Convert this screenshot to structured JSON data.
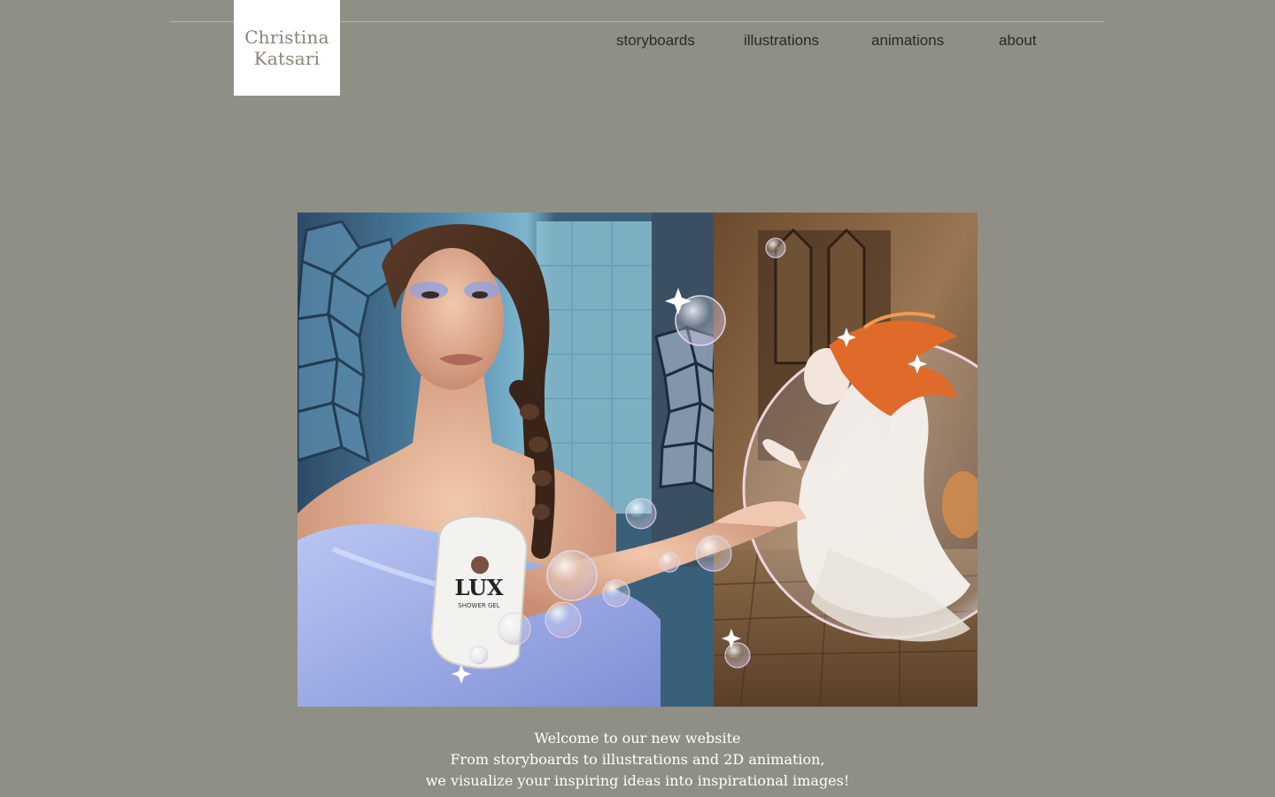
{
  "logo": {
    "line1": "Christina",
    "line2": "Katsari"
  },
  "nav": {
    "storyboards": "storyboards",
    "illustrations": "illustrations",
    "animations": "animations",
    "about": "about"
  },
  "hero": {
    "product_text": "LUX",
    "product_subtext": "SHOWER GEL"
  },
  "welcome": {
    "line1": "Welcome to our new website",
    "line2": "From storyboards to illustrations and 2D animation,",
    "line3": "we visualize your inspiring ideas into inspirational images!"
  },
  "colors": {
    "page_background": "#8f8f86",
    "logo_background": "#ffffff",
    "logo_text": "#8a8478",
    "nav_text": "#2a2a28",
    "welcome_text": "#ffffff"
  }
}
